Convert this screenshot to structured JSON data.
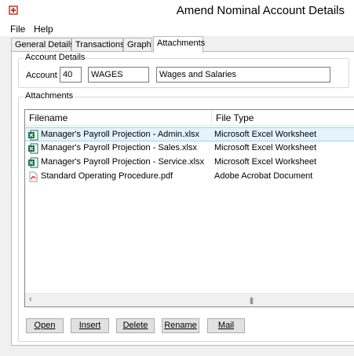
{
  "window": {
    "title": "Amend Nominal Account Details"
  },
  "menu": {
    "file": "File",
    "help": "Help"
  },
  "tabs": [
    "General Details",
    "Transactions",
    "Graph",
    "Attachments"
  ],
  "account_details": {
    "group_label": "Account Details",
    "account_label": "Account",
    "account_number": "40",
    "account_code": "WAGES",
    "account_name": "Wages and Salaries"
  },
  "attachments": {
    "group_label": "Attachments",
    "columns": [
      "Filename",
      "File Type"
    ],
    "rows": [
      {
        "filename": "Manager's Payroll Projection - Admin.xlsx",
        "type": "Microsoft Excel Worksheet",
        "icon": "excel-icon",
        "selected": true
      },
      {
        "filename": "Manager's Payroll Projection - Sales.xlsx",
        "type": "Microsoft Excel Worksheet",
        "icon": "excel-icon",
        "selected": false
      },
      {
        "filename": "Manager's Payroll Projection - Service.xlsx",
        "type": "Microsoft Excel Worksheet",
        "icon": "excel-icon",
        "selected": false
      },
      {
        "filename": "Standard Operating Procedure.pdf",
        "type": "Adobe Acrobat Document",
        "icon": "pdf-icon",
        "selected": false
      }
    ]
  },
  "buttons": {
    "open": "Open",
    "insert": "Insert",
    "delete": "Delete",
    "rename": "Rename",
    "mail": "Mail"
  },
  "colors": {
    "selection": "#e5f3fb",
    "selection_border": "#99d1ff",
    "excel": "#1e7145",
    "pdf": "#d9261c"
  }
}
